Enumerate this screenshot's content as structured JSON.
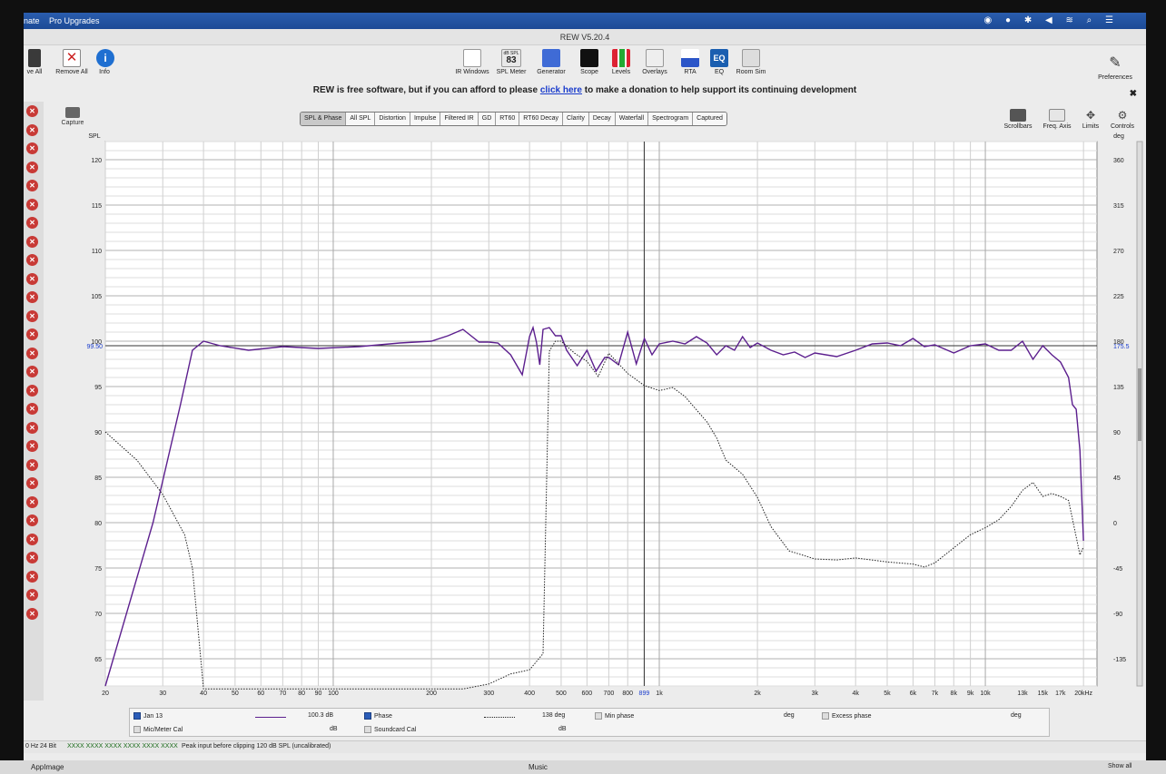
{
  "menubar": {
    "item1": "nate",
    "item2": "Pro Upgrades",
    "tray": "◉ ● ✱ ◀ ≋ ⌕ ☰"
  },
  "window": {
    "title": "REW V5.20.4"
  },
  "toolbar": {
    "left": [
      {
        "label": "ve All",
        "icon": "save-icon"
      },
      {
        "label": "Remove All",
        "icon": "remove-icon"
      },
      {
        "label": "Info",
        "icon": "info-icon"
      }
    ],
    "center": [
      {
        "label": "IR Windows",
        "icon": "ir-windows-icon"
      },
      {
        "label": "SPL Meter",
        "icon": "spl-meter-icon",
        "meter_caption": "dB SPL",
        "meter_value": "83"
      },
      {
        "label": "Generator",
        "icon": "generator-icon"
      },
      {
        "label": "Scope",
        "icon": "scope-icon"
      },
      {
        "label": "Levels",
        "icon": "levels-icon"
      },
      {
        "label": "Overlays",
        "icon": "overlays-icon"
      },
      {
        "label": "RTA",
        "icon": "rta-icon"
      },
      {
        "label": "EQ",
        "icon": "eq-icon"
      },
      {
        "label": "Room Sim",
        "icon": "room-sim-icon"
      }
    ],
    "preferences": "Preferences"
  },
  "donate": {
    "before": "REW is free software, but if you can afford to please",
    "link": "click here",
    "after": "to make a donation to help support its continuing development",
    "close": "✖"
  },
  "capture": "Capture",
  "graph_tabs": [
    "SPL & Phase",
    "All SPL",
    "Distortion",
    "Impulse",
    "Filtered IR",
    "GD",
    "RT60",
    "RT60 Decay",
    "Clarity",
    "Decay",
    "Waterfall",
    "Spectrogram",
    "Captured"
  ],
  "graph_controls": [
    "Scrollbars",
    "Freq. Axis",
    "Limits",
    "Controls"
  ],
  "chart_data": {
    "type": "line",
    "ylabel": "SPL",
    "y2label": "deg",
    "xscale": "log",
    "xlim": [
      20,
      22000
    ],
    "ylim": [
      62,
      122
    ],
    "y2lim": [
      -162,
      378
    ],
    "yticks": [
      "120",
      "115",
      "110",
      "105",
      "100",
      "95",
      "90",
      "85",
      "80",
      "75",
      "70",
      "65"
    ],
    "y2ticks": [
      "360",
      "315",
      "270",
      "225",
      "180",
      "135",
      "90",
      "45",
      "0",
      "-45",
      "-90",
      "-135"
    ],
    "xticks": [
      "20",
      "30",
      "40",
      "50",
      "60",
      "70",
      "80",
      "90",
      "100",
      "200",
      "300",
      "400",
      "500",
      "600",
      "700",
      "800",
      "899",
      "1k",
      "2k",
      "3k",
      "4k",
      "5k",
      "6k",
      "7k",
      "8k",
      "9k",
      "10k",
      "13k",
      "15k",
      "17k",
      "20kHz"
    ],
    "cursor_spl": "99.50",
    "cursor_phase": "175.5",
    "cursor_freq": "899",
    "series": [
      {
        "name": "Jan 13",
        "color": "#5c1f8e",
        "axis": "spl",
        "x": [
          20,
          28,
          34,
          37,
          40,
          45,
          55,
          70,
          90,
          120,
          160,
          200,
          225,
          250,
          280,
          300,
          320,
          350,
          380,
          400,
          410,
          420,
          430,
          440,
          460,
          480,
          500,
          520,
          560,
          600,
          640,
          680,
          700,
          750,
          800,
          850,
          900,
          950,
          1000,
          1100,
          1200,
          1300,
          1400,
          1500,
          1600,
          1700,
          1800,
          1900,
          2000,
          2200,
          2400,
          2600,
          2800,
          3000,
          3500,
          4000,
          4500,
          5000,
          5500,
          6000,
          6500,
          7000,
          8000,
          9000,
          10000,
          11000,
          12000,
          13000,
          14000,
          15000,
          16000,
          17000,
          18000,
          18500,
          19000,
          19500,
          20000
        ],
        "y": [
          62,
          80,
          93,
          99,
          100,
          99.5,
          99,
          99.4,
          99.2,
          99.4,
          99.8,
          100,
          100.6,
          101.3,
          99.9,
          99.9,
          99.8,
          98.5,
          96.3,
          100.5,
          101.5,
          99.9,
          97.4,
          101.3,
          101.5,
          100.6,
          100.6,
          99,
          97.3,
          99,
          96.7,
          98.2,
          98.2,
          97.4,
          101,
          97.5,
          100.3,
          98.5,
          99.7,
          100,
          99.7,
          100.5,
          99.8,
          98.5,
          99.5,
          99,
          100.5,
          99.3,
          99.8,
          99,
          98.5,
          98.8,
          98.2,
          98.7,
          98.3,
          99,
          99.7,
          99.8,
          99.5,
          100.3,
          99.4,
          99.6,
          98.7,
          99.5,
          99.7,
          99,
          99,
          100,
          98,
          99.5,
          98.5,
          97.7,
          96,
          93,
          92.5,
          88,
          78
        ]
      },
      {
        "name": "Phase",
        "color": "#222222",
        "axis": "phase",
        "x": [
          20,
          25,
          30,
          35,
          37,
          40,
          50,
          60,
          80,
          100,
          150,
          200,
          250,
          300,
          350,
          400,
          440,
          460,
          480,
          500,
          550,
          600,
          650,
          700,
          800,
          900,
          1000,
          1100,
          1200,
          1300,
          1400,
          1500,
          1600,
          1800,
          2000,
          2200,
          2500,
          3000,
          3500,
          4000,
          5000,
          6000,
          6500,
          7000,
          8000,
          9000,
          10000,
          11000,
          12000,
          13000,
          14000,
          15000,
          16000,
          17000,
          18000,
          19000,
          19500,
          20000
        ],
        "y": [
          90,
          62,
          28,
          -12,
          -45,
          -165,
          -165,
          -165,
          -165,
          -165,
          -165,
          -165,
          -165,
          -160,
          -150,
          -146,
          -130,
          170,
          180,
          180,
          168,
          160,
          145,
          168,
          148,
          136,
          131,
          134,
          125,
          112,
          100,
          84,
          62,
          48,
          25,
          -4,
          -28,
          -36,
          -37,
          -35,
          -39,
          -41,
          -44,
          -40,
          -25,
          -12,
          -5,
          3,
          16,
          32,
          40,
          26,
          29,
          26,
          22,
          -14,
          -32,
          -24
        ]
      },
      {
        "name": "Min phase",
        "color": "#666666",
        "axis": "phase"
      }
    ]
  },
  "legend": {
    "row1": [
      {
        "name": "Jan 13",
        "checked": true,
        "value": "100.3 dB"
      },
      {
        "name": "Phase",
        "checked": true,
        "value": "138 deg"
      },
      {
        "name": "Min phase",
        "checked": false,
        "value": "deg"
      },
      {
        "name": "Excess phase",
        "checked": false,
        "value": "deg"
      }
    ],
    "row2": [
      {
        "name": "Mic/Meter Cal",
        "checked": false,
        "value": "dB"
      },
      {
        "name": "Soundcard Cal",
        "checked": false,
        "value": "dB"
      }
    ]
  },
  "status": {
    "rate": "0 Hz",
    "bits": "24 Bit",
    "ids": "XXXX XXXX  XXXX XXXX  XXXX XXXX",
    "message": "Peak input before clipping 120 dB SPL (uncalibrated)"
  },
  "taskbar": {
    "app": "AppImage",
    "music": "Music",
    "showall": "Show all"
  }
}
